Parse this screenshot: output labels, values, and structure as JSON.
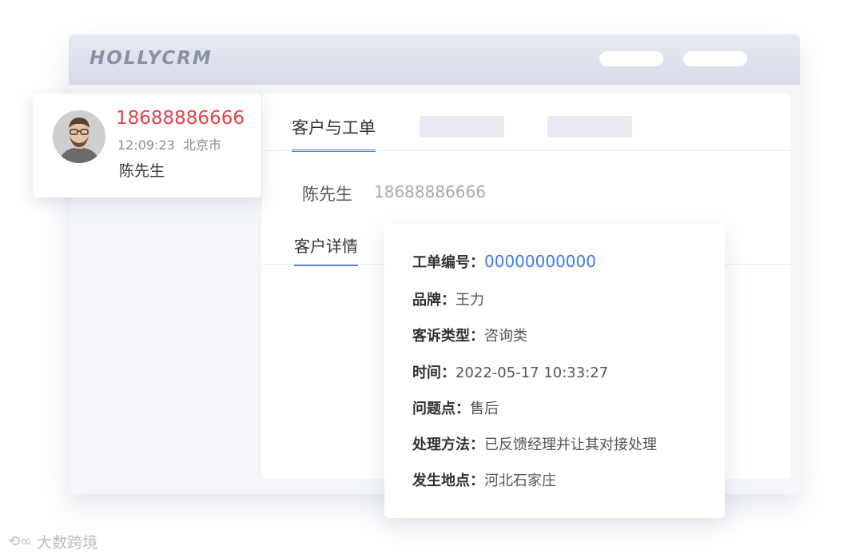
{
  "app": {
    "logo_text": "HOLLYCRM"
  },
  "caller": {
    "phone": "18688886666",
    "time": "12:09:23",
    "city": "北京市",
    "name": "陈先生"
  },
  "tabs": {
    "active_label": "客户与工单"
  },
  "customer": {
    "name": "陈先生",
    "phone": "18688886666",
    "detail_tab_label": "客户详情"
  },
  "work_order": {
    "rows": [
      {
        "key": "工单编号：",
        "value": "00000000000"
      },
      {
        "key": "品牌：",
        "value": "王力"
      },
      {
        "key": "客诉类型：",
        "value": "咨询类"
      },
      {
        "key": "时间：",
        "value": "2022-05-17 10:33:27"
      },
      {
        "key": "问题点：",
        "value": "售后"
      },
      {
        "key": "处理方法：",
        "value": "已反馈经理并让其对接处理"
      },
      {
        "key": "发生地点：",
        "value": "河北石家庄"
      }
    ]
  },
  "watermark": {
    "text": "大数跨境"
  },
  "colors": {
    "accent": "#5b87d6",
    "link": "#3d7be0",
    "phone_red": "#e2434a"
  }
}
